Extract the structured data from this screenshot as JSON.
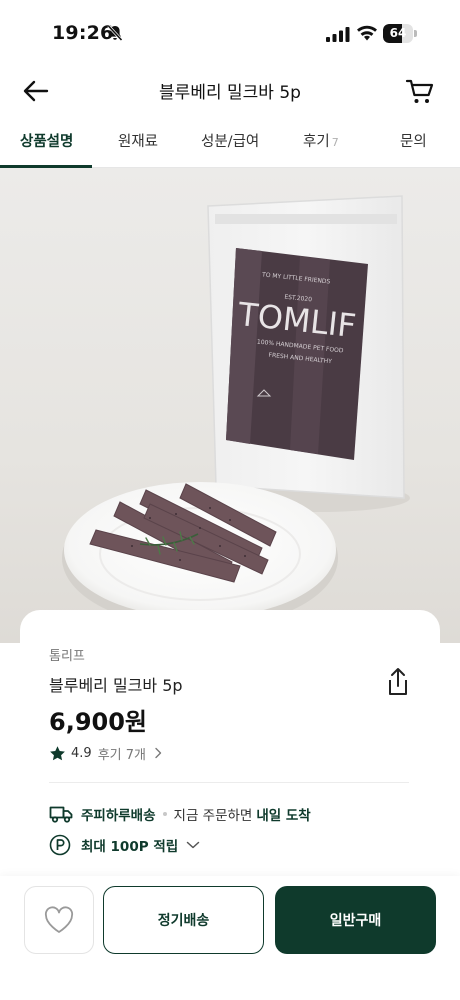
{
  "status_bar": {
    "time": "19:26",
    "battery": "64",
    "battery_level": 0.64
  },
  "header": {
    "title": "블루베리 밀크바 5p",
    "back_icon": "arrow-left-icon",
    "cart_icon": "cart-icon"
  },
  "tabs": [
    {
      "label": "상품설명",
      "active": true
    },
    {
      "label": "원재료",
      "active": false
    },
    {
      "label": "성분/급여",
      "active": false
    },
    {
      "label": "후기",
      "count": "7",
      "active": false
    },
    {
      "label": "문의",
      "active": false
    }
  ],
  "product_image": {
    "package_brand": "TOMLIF",
    "package_tagline": "TO MY LITTLE FRIENDS",
    "package_est": "EST.2020",
    "package_line1": "100% HANDMADE PET FOOD",
    "package_line2": "FRESH AND HEALTHY"
  },
  "product": {
    "brand": "톰리프",
    "name": "블루베리 밀크바 5p",
    "price": "6,900원",
    "rating": "4.9",
    "reviews": "후기 7개"
  },
  "delivery": {
    "title": "주피하루배송",
    "text": "지금 주문하면",
    "strong": "내일 도착"
  },
  "points": {
    "text": "최대 100P 적립"
  },
  "bottom": {
    "subscription_label": "정기배송",
    "buy_label": "일반구매"
  },
  "colors": {
    "accent": "#0f3a2c",
    "background": "#ffffff",
    "image_background": "#e7e5e2"
  }
}
